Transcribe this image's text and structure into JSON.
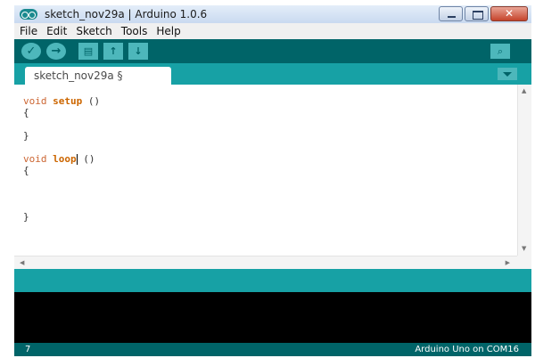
{
  "window": {
    "title": "sketch_nov29a | Arduino 1.0.6",
    "close_glyph": "✕"
  },
  "menu": {
    "items": [
      "File",
      "Edit",
      "Sketch",
      "Tools",
      "Help"
    ]
  },
  "toolbar": {
    "verify_glyph": "✓",
    "upload_glyph": "→",
    "new_glyph": "▤",
    "open_glyph": "↑",
    "save_glyph": "↓",
    "serial_glyph": "⌕"
  },
  "tab": {
    "label": "sketch_nov29a §"
  },
  "editor": {
    "lines": [
      {
        "kw": "void",
        "fn": "setup",
        "rest": " ()"
      },
      {
        "text": "{"
      },
      {
        "text": ""
      },
      {
        "text": "}"
      },
      {
        "text": ""
      },
      {
        "kw": "void",
        "fn": "loop",
        "rest": " ()",
        "cursor": true
      },
      {
        "text": "{"
      },
      {
        "text": ""
      },
      {
        "text": ""
      },
      {
        "text": ""
      },
      {
        "text": "}"
      }
    ]
  },
  "status": {
    "line_number": "7",
    "board": "Arduino Uno on COM16"
  },
  "colors": {
    "toolbar": "#006468",
    "accent": "#17a1a5",
    "keyword": "#cc6633"
  }
}
